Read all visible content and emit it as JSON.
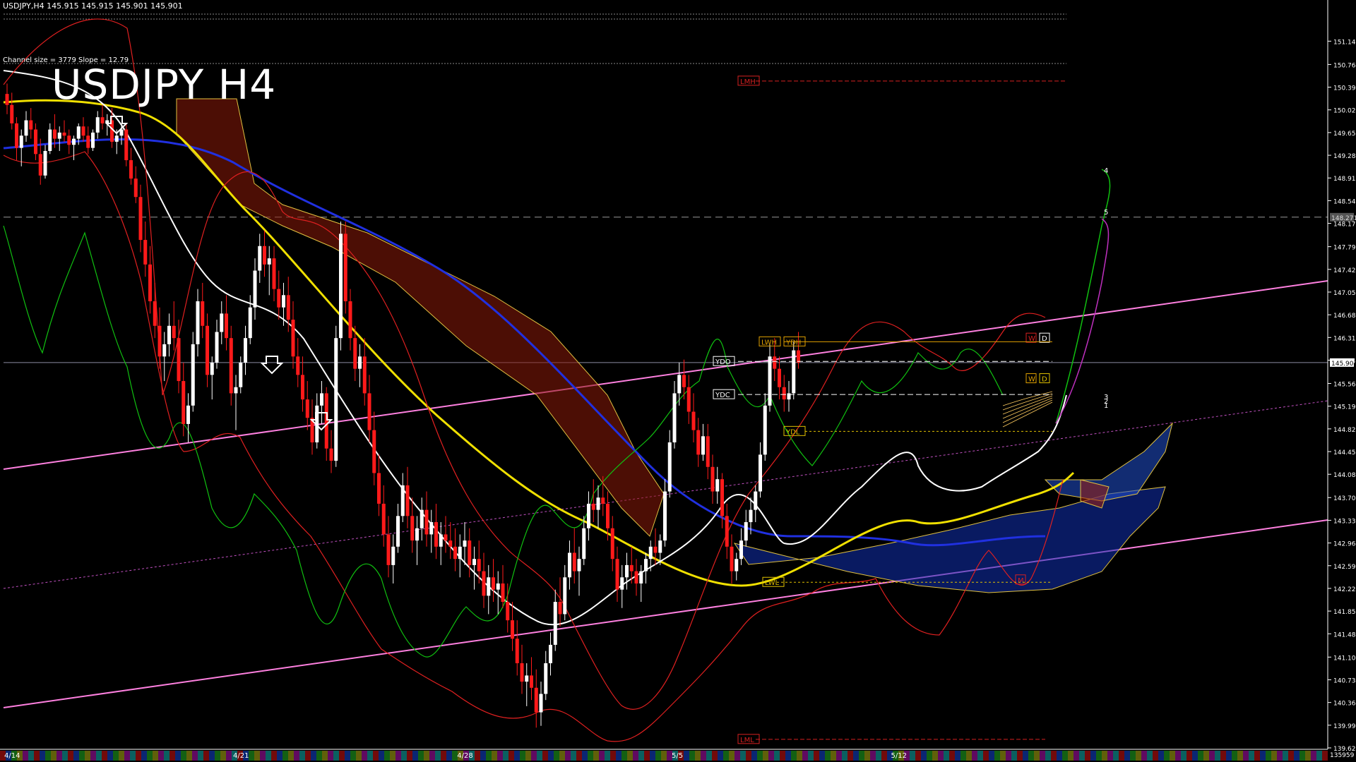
{
  "header": {
    "symbol_line": "USDJPY,H4  145.915 145.915 145.901 145.901",
    "channel_info": "Channel size = 3779 Slope = 12.79",
    "big_title": "USDJPY H4"
  },
  "current_price": "145.901",
  "marker_price": "148.271",
  "bottom_right_label": "135959",
  "chart_data": {
    "type": "candlestick",
    "ylim": [
      139.62,
      151.42
    ],
    "price_ticks": [
      "151.140",
      "150.760",
      "150.390",
      "150.020",
      "149.650",
      "149.280",
      "148.910",
      "148.540",
      "148.170",
      "147.790",
      "147.420",
      "147.050",
      "146.680",
      "146.310",
      "145.940",
      "145.560",
      "145.190",
      "144.820",
      "144.450",
      "144.080",
      "143.700",
      "143.330",
      "142.960",
      "142.590",
      "142.220",
      "141.850",
      "141.480",
      "141.100",
      "140.730",
      "140.360",
      "139.990",
      "139.620"
    ],
    "date_ticks": [
      {
        "label": "4/14",
        "bar": 0
      },
      {
        "label": "4/21",
        "bar": 48
      },
      {
        "label": "4/28",
        "bar": 95
      },
      {
        "label": "5/5",
        "bar": 140
      },
      {
        "label": "5/12",
        "bar": 186
      }
    ],
    "level_labels": [
      {
        "text": "LMH",
        "price": 150.49,
        "color": "#d62020"
      },
      {
        "text": "LML",
        "price": 139.76,
        "color": "#d62020"
      },
      {
        "text": "YDO",
        "price": 145.92,
        "color": "#ffffff"
      },
      {
        "text": "YDC",
        "price": 145.38,
        "color": "#ffffff"
      },
      {
        "text": "LWH",
        "price": 146.24,
        "color": "#e0a000"
      },
      {
        "text": "YDH",
        "price": 146.24,
        "color": "#e0a000"
      },
      {
        "text": "YDL",
        "price": 144.78,
        "color": "#e0c000"
      },
      {
        "text": "LWL",
        "price": 142.32,
        "color": "#e0c000"
      },
      {
        "text": "W",
        "price": 146.3,
        "color": "#d62020"
      },
      {
        "text": "D",
        "price": 146.3,
        "color": "#ffffff"
      },
      {
        "text": "W",
        "price": 145.64,
        "color": "#e0a000"
      },
      {
        "text": "D",
        "price": 145.64,
        "color": "#e0c000"
      },
      {
        "text": "M",
        "price": 142.36,
        "color": "#d62020"
      }
    ],
    "wave_labels": [
      "4",
      "5",
      "3",
      "2",
      "1"
    ],
    "candles": [
      [
        150.28,
        150.45,
        149.95,
        150.1
      ],
      [
        150.1,
        150.3,
        149.7,
        149.8
      ],
      [
        149.8,
        149.9,
        149.2,
        149.4
      ],
      [
        149.4,
        149.7,
        149.1,
        149.6
      ],
      [
        149.6,
        150.0,
        149.5,
        149.85
      ],
      [
        149.85,
        150.05,
        149.55,
        149.7
      ],
      [
        149.7,
        149.8,
        149.2,
        149.3
      ],
      [
        149.3,
        149.55,
        148.8,
        148.95
      ],
      [
        148.95,
        149.45,
        148.9,
        149.35
      ],
      [
        149.35,
        149.8,
        149.3,
        149.7
      ],
      [
        149.7,
        149.95,
        149.4,
        149.55
      ],
      [
        149.55,
        149.75,
        149.35,
        149.65
      ],
      [
        149.65,
        149.85,
        149.5,
        149.6
      ],
      [
        149.6,
        149.7,
        149.3,
        149.45
      ],
      [
        149.45,
        149.6,
        149.2,
        149.55
      ],
      [
        149.55,
        149.8,
        149.45,
        149.75
      ],
      [
        149.75,
        149.9,
        149.5,
        149.6
      ],
      [
        149.6,
        149.75,
        149.3,
        149.4
      ],
      [
        149.4,
        149.7,
        149.35,
        149.65
      ],
      [
        149.65,
        150.0,
        149.55,
        149.9
      ],
      [
        149.9,
        150.1,
        149.7,
        149.8
      ],
      [
        149.8,
        149.95,
        149.6,
        149.85
      ],
      [
        149.85,
        150.05,
        149.4,
        149.5
      ],
      [
        149.5,
        149.7,
        149.3,
        149.6
      ],
      [
        149.6,
        149.8,
        149.45,
        149.7
      ],
      [
        149.7,
        149.8,
        149.1,
        149.2
      ],
      [
        149.2,
        149.4,
        148.8,
        148.9
      ],
      [
        148.9,
        149.1,
        148.5,
        148.6
      ],
      [
        148.6,
        148.8,
        147.7,
        147.9
      ],
      [
        147.9,
        148.2,
        147.3,
        147.5
      ],
      [
        147.5,
        147.8,
        146.7,
        146.9
      ],
      [
        146.9,
        147.2,
        146.3,
        146.5
      ],
      [
        146.5,
        146.8,
        145.8,
        146.0
      ],
      [
        146.0,
        146.4,
        145.6,
        146.2
      ],
      [
        146.2,
        146.7,
        146.0,
        146.5
      ],
      [
        146.5,
        146.9,
        146.1,
        146.3
      ],
      [
        146.3,
        146.6,
        145.4,
        145.6
      ],
      [
        145.6,
        145.9,
        144.7,
        144.9
      ],
      [
        144.9,
        145.4,
        144.6,
        145.2
      ],
      [
        145.2,
        146.4,
        145.1,
        146.2
      ],
      [
        146.2,
        147.1,
        146.0,
        146.9
      ],
      [
        146.9,
        147.2,
        146.3,
        146.5
      ],
      [
        146.5,
        146.7,
        145.5,
        145.7
      ],
      [
        145.7,
        146.0,
        145.3,
        145.9
      ],
      [
        145.9,
        146.6,
        145.8,
        146.4
      ],
      [
        146.4,
        146.9,
        146.2,
        146.7
      ],
      [
        146.7,
        147.0,
        146.1,
        146.3
      ],
      [
        146.3,
        146.5,
        145.2,
        145.4
      ],
      [
        145.4,
        145.7,
        144.8,
        145.5
      ],
      [
        145.5,
        146.0,
        145.4,
        145.9
      ],
      [
        145.9,
        146.5,
        145.7,
        146.3
      ],
      [
        146.3,
        147.0,
        146.2,
        146.8
      ],
      [
        146.8,
        147.6,
        146.6,
        147.4
      ],
      [
        147.4,
        148.0,
        147.2,
        147.8
      ],
      [
        147.8,
        148.05,
        147.3,
        147.5
      ],
      [
        147.5,
        147.8,
        147.0,
        147.6
      ],
      [
        147.6,
        147.8,
        146.9,
        147.1
      ],
      [
        147.1,
        147.4,
        146.6,
        146.8
      ],
      [
        146.8,
        147.2,
        146.5,
        147.0
      ],
      [
        147.0,
        147.3,
        146.4,
        146.6
      ],
      [
        146.6,
        146.9,
        145.8,
        146.0
      ],
      [
        146.0,
        146.3,
        145.5,
        145.7
      ],
      [
        145.7,
        146.0,
        145.1,
        145.3
      ],
      [
        145.3,
        145.6,
        144.8,
        145.0
      ],
      [
        145.0,
        145.3,
        144.4,
        144.6
      ],
      [
        144.6,
        145.4,
        144.5,
        145.2
      ],
      [
        145.2,
        145.6,
        144.9,
        145.4
      ],
      [
        145.4,
        145.5,
        144.3,
        144.5
      ],
      [
        144.5,
        144.8,
        144.1,
        144.3
      ],
      [
        144.3,
        146.5,
        144.2,
        146.3
      ],
      [
        146.3,
        148.2,
        146.1,
        148.0
      ],
      [
        148.0,
        148.2,
        146.7,
        146.9
      ],
      [
        146.9,
        147.1,
        146.1,
        146.3
      ],
      [
        146.3,
        146.5,
        145.6,
        145.8
      ],
      [
        145.8,
        146.2,
        145.5,
        146.0
      ],
      [
        146.0,
        146.3,
        145.2,
        145.4
      ],
      [
        145.4,
        145.7,
        144.6,
        144.8
      ],
      [
        144.8,
        145.1,
        143.9,
        144.1
      ],
      [
        144.1,
        144.4,
        143.4,
        143.6
      ],
      [
        143.6,
        143.9,
        142.9,
        143.1
      ],
      [
        143.1,
        143.4,
        142.4,
        142.6
      ],
      [
        142.6,
        143.1,
        142.3,
        142.9
      ],
      [
        142.9,
        143.6,
        142.8,
        143.4
      ],
      [
        143.4,
        144.1,
        143.3,
        143.9
      ],
      [
        143.9,
        144.2,
        143.2,
        143.4
      ],
      [
        143.4,
        143.7,
        142.8,
        143.0
      ],
      [
        143.0,
        143.4,
        142.6,
        143.2
      ],
      [
        143.2,
        143.7,
        143.0,
        143.5
      ],
      [
        143.5,
        143.8,
        142.9,
        143.1
      ],
      [
        143.1,
        143.5,
        142.8,
        143.3
      ],
      [
        143.3,
        143.6,
        142.7,
        142.9
      ],
      [
        142.9,
        143.3,
        142.6,
        143.1
      ],
      [
        143.1,
        143.4,
        142.8,
        143.0
      ],
      [
        143.0,
        143.3,
        142.7,
        142.9
      ],
      [
        142.9,
        143.2,
        142.5,
        142.7
      ],
      [
        142.7,
        143.1,
        142.4,
        142.9
      ],
      [
        142.9,
        143.3,
        142.6,
        143.0
      ],
      [
        143.0,
        143.2,
        142.4,
        142.6
      ],
      [
        142.6,
        142.9,
        142.2,
        142.7
      ],
      [
        142.7,
        143.0,
        142.3,
        142.5
      ],
      [
        142.5,
        142.8,
        141.9,
        142.1
      ],
      [
        142.1,
        142.6,
        141.8,
        142.4
      ],
      [
        142.4,
        142.7,
        142.0,
        142.2
      ],
      [
        142.2,
        142.5,
        141.8,
        142.3
      ],
      [
        142.3,
        142.6,
        141.9,
        142.0
      ],
      [
        142.0,
        142.3,
        141.5,
        141.7
      ],
      [
        141.7,
        142.0,
        141.2,
        141.4
      ],
      [
        141.4,
        141.7,
        140.8,
        141.0
      ],
      [
        141.0,
        141.3,
        140.5,
        140.7
      ],
      [
        140.7,
        141.0,
        140.3,
        140.8
      ],
      [
        140.8,
        141.1,
        140.4,
        140.6
      ],
      [
        140.6,
        140.9,
        139.95,
        140.2
      ],
      [
        140.2,
        140.7,
        139.98,
        140.5
      ],
      [
        140.5,
        141.2,
        140.4,
        141.0
      ],
      [
        141.0,
        141.5,
        140.8,
        141.3
      ],
      [
        141.3,
        142.2,
        141.2,
        142.0
      ],
      [
        142.0,
        142.4,
        141.6,
        141.8
      ],
      [
        141.8,
        142.6,
        141.7,
        142.4
      ],
      [
        142.4,
        143.0,
        142.2,
        142.8
      ],
      [
        142.8,
        143.2,
        142.3,
        142.5
      ],
      [
        142.5,
        142.9,
        142.1,
        142.7
      ],
      [
        142.7,
        143.4,
        142.6,
        143.2
      ],
      [
        143.2,
        143.8,
        143.0,
        143.6
      ],
      [
        143.6,
        144.0,
        143.3,
        143.5
      ],
      [
        143.5,
        143.9,
        143.2,
        143.7
      ],
      [
        143.7,
        144.05,
        143.4,
        143.6
      ],
      [
        143.6,
        143.8,
        143.0,
        143.2
      ],
      [
        143.2,
        143.4,
        142.5,
        142.7
      ],
      [
        142.7,
        142.9,
        142.0,
        142.2
      ],
      [
        142.2,
        142.6,
        141.9,
        142.4
      ],
      [
        142.4,
        142.8,
        142.2,
        142.6
      ],
      [
        142.6,
        142.9,
        142.3,
        142.5
      ],
      [
        142.5,
        142.7,
        142.1,
        142.3
      ],
      [
        142.3,
        142.6,
        142.0,
        142.5
      ],
      [
        142.5,
        142.8,
        142.3,
        142.7
      ],
      [
        142.7,
        143.0,
        142.5,
        142.9
      ],
      [
        142.9,
        143.2,
        142.6,
        142.8
      ],
      [
        142.8,
        143.1,
        142.6,
        143.0
      ],
      [
        143.0,
        144.0,
        142.9,
        143.8
      ],
      [
        143.8,
        144.8,
        143.7,
        144.6
      ],
      [
        144.6,
        145.6,
        144.5,
        145.4
      ],
      [
        145.4,
        145.9,
        145.2,
        145.7
      ],
      [
        145.7,
        145.95,
        145.3,
        145.5
      ],
      [
        145.5,
        145.7,
        144.9,
        145.1
      ],
      [
        145.1,
        145.4,
        144.6,
        144.8
      ],
      [
        144.8,
        145.0,
        144.2,
        144.4
      ],
      [
        144.4,
        144.9,
        144.3,
        144.7
      ],
      [
        144.7,
        144.9,
        144.0,
        144.2
      ],
      [
        144.2,
        144.4,
        143.6,
        143.8
      ],
      [
        143.8,
        144.2,
        143.6,
        144.0
      ],
      [
        144.0,
        144.1,
        143.2,
        143.4
      ],
      [
        143.4,
        143.6,
        142.7,
        142.9
      ],
      [
        142.9,
        143.1,
        142.3,
        142.5
      ],
      [
        142.5,
        142.8,
        142.35,
        142.7
      ],
      [
        142.7,
        143.2,
        142.6,
        143.0
      ],
      [
        143.0,
        143.5,
        142.9,
        143.3
      ],
      [
        143.3,
        143.7,
        143.1,
        143.5
      ],
      [
        143.5,
        143.9,
        143.3,
        143.8
      ],
      [
        143.8,
        144.6,
        143.7,
        144.4
      ],
      [
        144.4,
        145.4,
        144.3,
        145.2
      ],
      [
        145.2,
        146.2,
        145.1,
        146.0
      ],
      [
        146.0,
        146.3,
        145.6,
        145.8
      ],
      [
        145.8,
        146.0,
        145.3,
        145.5
      ],
      [
        145.5,
        145.7,
        145.1,
        145.3
      ],
      [
        145.3,
        145.6,
        145.1,
        145.4
      ],
      [
        145.4,
        146.25,
        145.3,
        146.1
      ],
      [
        146.1,
        146.4,
        145.8,
        145.9
      ]
    ]
  }
}
